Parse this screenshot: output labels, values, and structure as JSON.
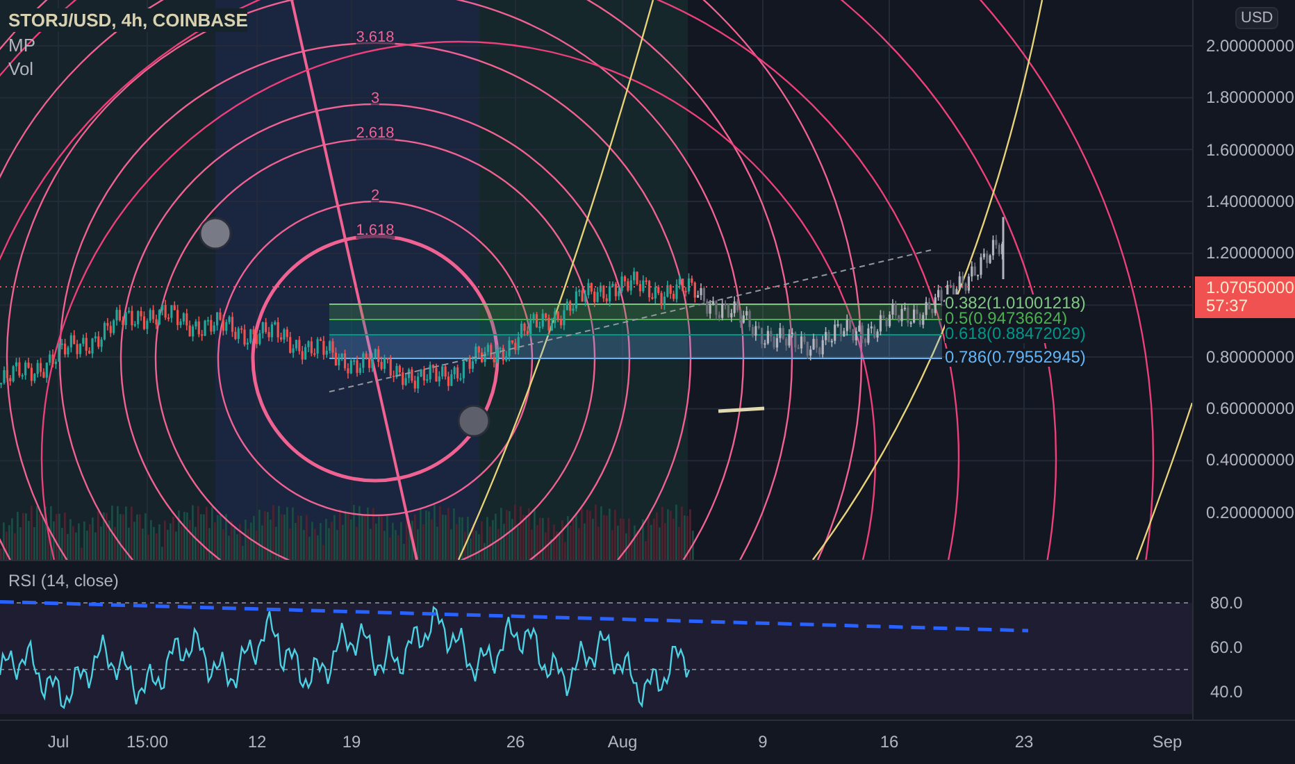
{
  "symbol_legend": {
    "title": "STORJ/USD, 4h, COINBASE",
    "indicators": [
      "MP",
      "Vol"
    ]
  },
  "fib_circles": {
    "levels": [
      "3.618",
      "3",
      "2.618",
      "2",
      "1.618"
    ]
  },
  "fib_retracement": {
    "levels": [
      {
        "label": "0.382(1.01001218)",
        "color": "#81c784"
      },
      {
        "label": "0.5(0.94736624)",
        "color": "#4caf50"
      },
      {
        "label": "0.618(0.88472029)",
        "color": "#009688"
      },
      {
        "label": "0.786(0.79552945)",
        "color": "#64b5f6"
      }
    ]
  },
  "price_axis": {
    "currency": "USD",
    "ticks": [
      "2.00000000",
      "1.80000000",
      "1.60000000",
      "1.40000000",
      "1.20000000",
      "0.80000000",
      "0.60000000",
      "0.40000000",
      "0.20000000"
    ],
    "last_price": "1.07050000",
    "countdown": "57:37"
  },
  "rsi": {
    "title": "RSI (14, close)",
    "ticks": [
      "80.0",
      "60.0",
      "40.0"
    ]
  },
  "time_axis": {
    "labels": [
      "Jul",
      "15:00",
      "12",
      "19",
      "26",
      "Aug",
      "9",
      "16",
      "23",
      "Sep"
    ]
  }
}
